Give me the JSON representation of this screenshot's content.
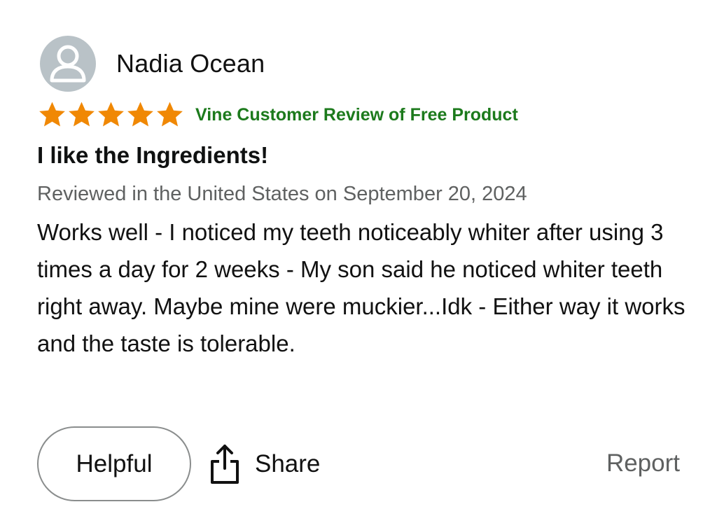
{
  "reviewer": {
    "name": "Nadia Ocean",
    "avatar_icon": "user-silhouette-icon"
  },
  "rating": {
    "value": 5,
    "max": 5,
    "star_color": "#f08804",
    "badge_text": "Vine Customer Review of Free Product",
    "badge_color": "#1c7a1c"
  },
  "review": {
    "title": "I like the Ingredients!",
    "date_line": "Reviewed in the United States on September 20, 2024",
    "body": "Works well - I noticed my teeth noticeably whiter after using 3 times a day for 2 weeks - My son said he noticed whiter teeth right away. Maybe mine were muckier...Idk - Either way it works and the taste is tolerable."
  },
  "actions": {
    "helpful_label": "Helpful",
    "share_label": "Share",
    "share_icon": "share-icon",
    "report_label": "Report"
  }
}
